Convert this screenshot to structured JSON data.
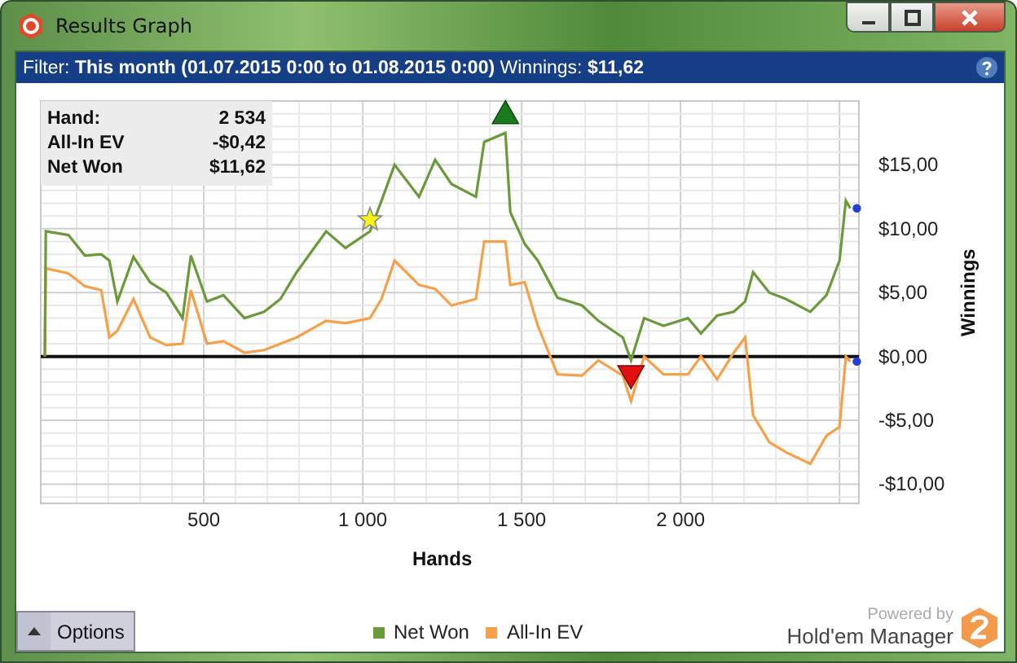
{
  "window": {
    "title": "Results Graph"
  },
  "filter": {
    "label": "Filter:",
    "value": "This month (01.07.2015 0:00 to 01.08.2015 0:00)",
    "winnings_label": "Winnings:",
    "winnings_value": "$11,62"
  },
  "stats": [
    {
      "label": "Hand:",
      "value": "2 534"
    },
    {
      "label": "All-In EV",
      "value": "-$0,42"
    },
    {
      "label": "Net Won",
      "value": "$11,62"
    }
  ],
  "chart_data": {
    "type": "line",
    "xlabel": "Hands",
    "ylabel": "Winnings",
    "xlim": [
      -13,
      2561
    ],
    "ylim": [
      -11.5,
      20
    ],
    "xticks": [
      {
        "value": 500,
        "label": "500"
      },
      {
        "value": 1000,
        "label": "1 000"
      },
      {
        "value": 1500,
        "label": "1 500"
      },
      {
        "value": 2000,
        "label": "2 000"
      }
    ],
    "yticks": [
      {
        "value": 15,
        "label": "$15,00"
      },
      {
        "value": 10,
        "label": "$10,00"
      },
      {
        "value": 5,
        "label": "$5,00"
      },
      {
        "value": 0,
        "label": "$0,00"
      },
      {
        "value": -5,
        "label": "-$5,00"
      },
      {
        "value": -10,
        "label": "-$10,00"
      }
    ],
    "x": [
      0,
      3,
      74,
      126,
      177,
      203,
      228,
      279,
      331,
      382,
      433,
      459,
      510,
      562,
      628,
      690,
      741,
      792,
      885,
      946,
      1023,
      1059,
      1100,
      1177,
      1228,
      1279,
      1356,
      1382,
      1449,
      1464,
      1510,
      1551,
      1613,
      1690,
      1741,
      1818,
      1844,
      1885,
      1946,
      2023,
      2064,
      2115,
      2167,
      2203,
      2228,
      2279,
      2331,
      2408,
      2459,
      2500,
      2520,
      2534
    ],
    "series": [
      {
        "name": "Net Won",
        "color": "#6a9a3a",
        "values": [
          0,
          9.8,
          9.5,
          7.9,
          8.0,
          7.5,
          4.3,
          7.8,
          5.8,
          5.0,
          3.0,
          7.9,
          4.3,
          4.8,
          3.0,
          3.5,
          4.5,
          6.6,
          9.8,
          8.5,
          9.8,
          12.2,
          15.0,
          12.5,
          15.4,
          13.5,
          12.5,
          16.8,
          17.5,
          11.3,
          8.8,
          7.5,
          4.6,
          4.0,
          2.8,
          1.5,
          -0.3,
          3.0,
          2.4,
          3.0,
          1.8,
          3.2,
          3.5,
          4.3,
          6.6,
          5.0,
          4.5,
          3.5,
          4.8,
          7.5,
          12.2,
          11.6
        ]
      },
      {
        "name": "All-In EV",
        "color": "#f7a04a",
        "values": [
          0,
          6.9,
          6.5,
          5.5,
          5.2,
          1.5,
          2.0,
          4.5,
          1.5,
          0.9,
          1.0,
          5.2,
          1.0,
          1.2,
          0.3,
          0.5,
          1.0,
          1.5,
          2.8,
          2.6,
          3.0,
          4.5,
          7.5,
          5.6,
          5.3,
          4.0,
          4.5,
          9.0,
          9.0,
          5.6,
          5.8,
          2.4,
          -1.4,
          -1.5,
          -0.3,
          -1.5,
          -3.5,
          0,
          -1.4,
          -1.4,
          0,
          -1.8,
          0.3,
          1.5,
          -4.6,
          -6.7,
          -7.5,
          -8.4,
          -6.2,
          -5.5,
          0,
          -0.4
        ]
      }
    ],
    "grid": true
  },
  "options_button": {
    "label": "Options"
  },
  "branding": {
    "tagline": "Powered by",
    "product": "Hold'em Manager"
  }
}
